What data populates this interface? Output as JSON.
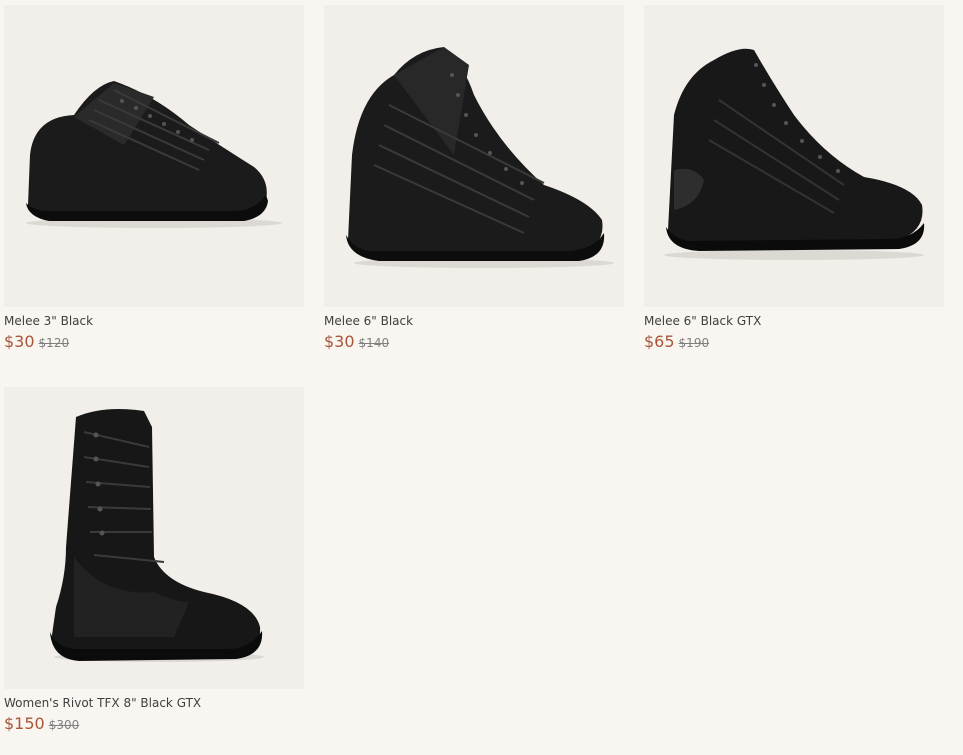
{
  "products": [
    {
      "name": "Melee 3\" Black",
      "price": "$30",
      "was": "$120",
      "image_icon": "low-top-black-shoe-icon"
    },
    {
      "name": "Melee 6\" Black",
      "price": "$30",
      "was": "$140",
      "image_icon": "mid-top-black-boot-icon"
    },
    {
      "name": "Melee 6\" Black GTX",
      "price": "$65",
      "was": "$190",
      "image_icon": "mid-top-black-leather-boot-icon"
    },
    {
      "name": "Women's Rivot TFX 8\" Black GTX",
      "price": "$150",
      "was": "$300",
      "image_icon": "tall-black-boot-icon"
    }
  ],
  "colors": {
    "background": "#f9f6f1",
    "thumb_bg": "#f2efea",
    "sale_price": "#a8553a",
    "strike_price": "#808080"
  }
}
